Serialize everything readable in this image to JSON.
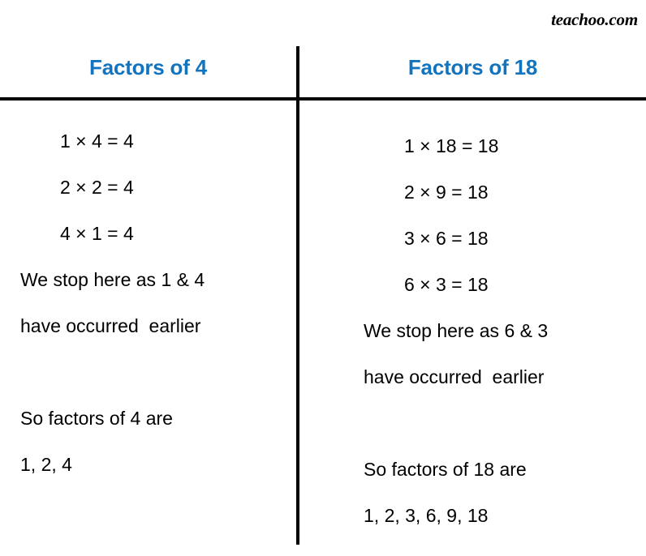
{
  "watermark": "teachoo.com",
  "colors": {
    "header_blue": "#1273be",
    "rule_black": "#000000",
    "text_black": "#000000",
    "background": "#ffffff"
  },
  "columns": {
    "left": {
      "header": "Factors of 4",
      "lines": [
        {
          "kind": "eq",
          "text": "1 × 4 = 4"
        },
        {
          "kind": "eq",
          "text": "2 × 2 = 4"
        },
        {
          "kind": "eq",
          "text": "4 × 1 = 4"
        },
        {
          "kind": "txt",
          "text": "We stop here as 1 & 4"
        },
        {
          "kind": "txt",
          "text": "have occurred  earlier"
        },
        {
          "kind": "blank",
          "text": ""
        },
        {
          "kind": "txt",
          "text": "So factors of 4 are"
        },
        {
          "kind": "txt",
          "text": "1, 2, 4"
        }
      ]
    },
    "right": {
      "header": "Factors of 18",
      "lines": [
        {
          "kind": "eq",
          "text": "1 × 18 = 18"
        },
        {
          "kind": "eq",
          "text": "2 × 9 = 18"
        },
        {
          "kind": "eq",
          "text": "3 × 6 = 18"
        },
        {
          "kind": "eq",
          "text": "6 × 3 = 18"
        },
        {
          "kind": "txt",
          "text": "We stop here as 6 & 3"
        },
        {
          "kind": "txt",
          "text": "have occurred  earlier"
        },
        {
          "kind": "blank",
          "text": ""
        },
        {
          "kind": "txt",
          "text": "So factors of 18 are"
        },
        {
          "kind": "txt",
          "text": "1, 2, 3, 6, 9, 18"
        }
      ]
    }
  }
}
